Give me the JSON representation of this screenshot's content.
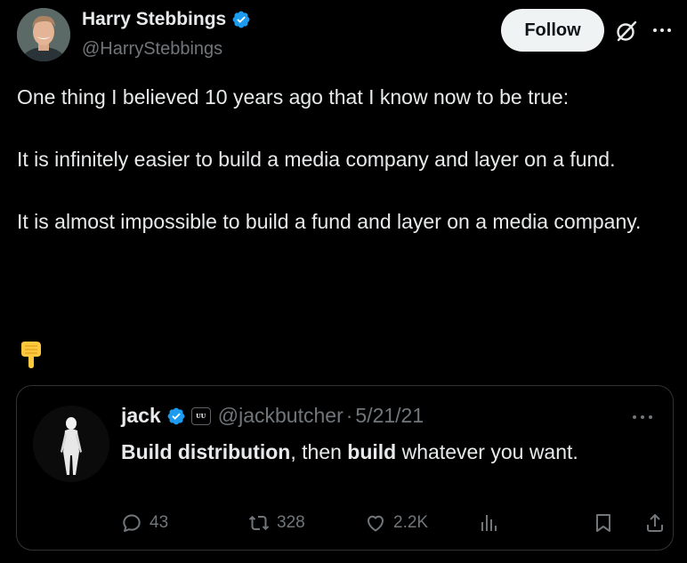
{
  "author": {
    "name": "Harry Stebbings",
    "handle": "@HarryStebbings"
  },
  "actions": {
    "follow_label": "Follow"
  },
  "tweet": {
    "paragraphs": [
      "One thing I believed 10 years ago that I know now to be true:",
      "It is infinitely easier to build a media company and layer on a fund.",
      "It is almost impossible to build a fund and layer on a media company."
    ],
    "emoji": "backhand-index-pointing-down"
  },
  "quoted_tweet": {
    "name": "jack",
    "affiliate_badge": "ᴜᴜ",
    "handle": "@jackbutcher",
    "separator": "·",
    "date": "5/21/21",
    "text_parts": [
      {
        "text": "Build distribution",
        "bold": true
      },
      {
        "text": ", then ",
        "bold": false
      },
      {
        "text": "build",
        "bold": true
      },
      {
        "text": " whatever you want.",
        "bold": false
      }
    ],
    "stats": {
      "replies": "43",
      "reposts": "328",
      "likes": "2.2K"
    }
  },
  "colors": {
    "background": "#000000",
    "text": "#e7e9ea",
    "muted": "#71767b",
    "verified": "#1d9bf0",
    "border": "#2f3336"
  }
}
